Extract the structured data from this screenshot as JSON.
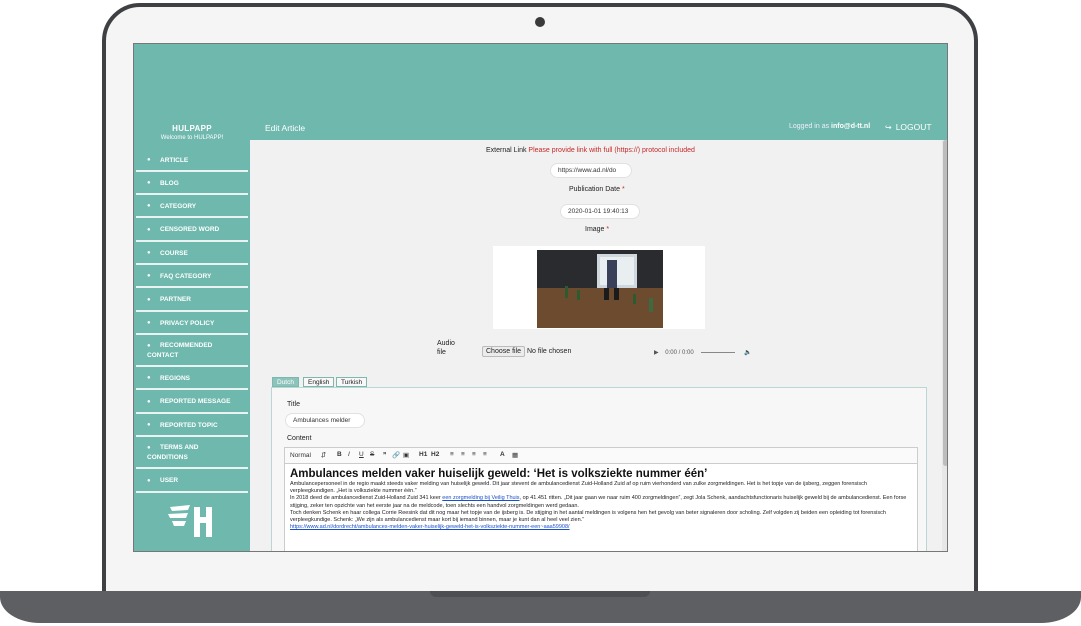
{
  "brand": {
    "title": "HULPAPP",
    "subtitle": "Welcome to HULPAPP!"
  },
  "header": {
    "page_title": "Edit Article",
    "logged_in_label": "Logged in as",
    "user_email": "info@d-tt.nl",
    "logout_label": "LOGOUT"
  },
  "sidebar": {
    "items": [
      {
        "label": "ARTICLE"
      },
      {
        "label": "BLOG"
      },
      {
        "label": "CATEGORY"
      },
      {
        "label": "CENSORED WORD"
      },
      {
        "label": "COURSE"
      },
      {
        "label": "FAQ CATEGORY"
      },
      {
        "label": "PARTNER"
      },
      {
        "label": "PRIVACY POLICY"
      },
      {
        "label": "RECOMMENDED",
        "label2": "CONTACT"
      },
      {
        "label": "REGIONS"
      },
      {
        "label": "REPORTED MESSAGE"
      },
      {
        "label": "REPORTED TOPIC"
      },
      {
        "label": "TERMS AND",
        "label2": "CONDITIONS"
      },
      {
        "label": "USER"
      }
    ]
  },
  "form": {
    "external_link_label": "External Link",
    "external_link_hint": "Please provide link with full (https://) protocol included",
    "external_link_value": "https://www.ad.nl/do",
    "publication_date_label": "Publication Date",
    "publication_date_value": "2020-01-01 19:40:13",
    "image_label": "Image",
    "required_mark": "*",
    "audio_label": "Audio",
    "audio_label2": "file",
    "choose_file_button": "Choose file",
    "no_file_text": "No file chosen",
    "audio_time": "0:00 / 0:00"
  },
  "tabs": [
    {
      "label": "Dutch",
      "active": true
    },
    {
      "label": "English",
      "active": false
    },
    {
      "label": "Turkish",
      "active": false
    }
  ],
  "content": {
    "title_label": "Title",
    "title_value": "Ambulances melder",
    "content_label": "Content",
    "toolbar": {
      "format_select": "Normal",
      "bold": "B",
      "italic": "I",
      "underline": "U",
      "strike": "S",
      "h1": "H1",
      "h2": "H2",
      "color": "A"
    },
    "editor": {
      "heading": "Ambulances melden vaker huiselijk geweld: ‘Het is volksziekte nummer één’",
      "p1": "Ambulancepersoneel in de regio maakt steeds vaker melding van huiselijk geweld. Dit jaar stevent de ambulancedienst Zuid-Holland Zuid af op ruim vierhonderd van zulke zorgmeldingen. Het is het topje van de ijsberg, zeggen forensisch verpleegkundigen. „Het is volksziekte nummer één.”",
      "p2_a": "In 2018 deed de ambulancedienst Zuid-Holland Zuid 341 keer",
      "p2_link": "een zorgmelding bij Veilig Thuis",
      "p2_b": ", op 41.451 ritten. „Dit jaar gaan we naar ruim 400 zorgmeldingen”, zegt Jola Schenk, aandachtsfunctionaris huiselijk geweld bij de ambulancedienst. Een forse stijging, zeker ten opzichte van het eerste jaar na de meldcode, toen slechts een handvol zorgmeldingen werd gedaan.",
      "p3": "Toch denken Schenk en haar collega Corrie Reesink dat dit nog maar het topje van de ijsberg is. De stijging in het aantal meldingen is volgens hen het gevolg van beter signaleren door scholing. Zelf volgden zij beiden een opleiding tot forensisch verpleegkundige. Schenk: „We zijn als ambulancedienst maar kort bij iemand binnen, maar je kunt dan al heel veel zien.”",
      "p4_link": "https://www.ad.nl/dordrecht/ambulances-melden-vaker-huiselijk-geweld-het-is-volksziekte-nummer-een~aaa59908/"
    }
  },
  "colors": {
    "accent": "#6fb8ad",
    "required": "#c62828",
    "link": "#1a4fcc"
  }
}
